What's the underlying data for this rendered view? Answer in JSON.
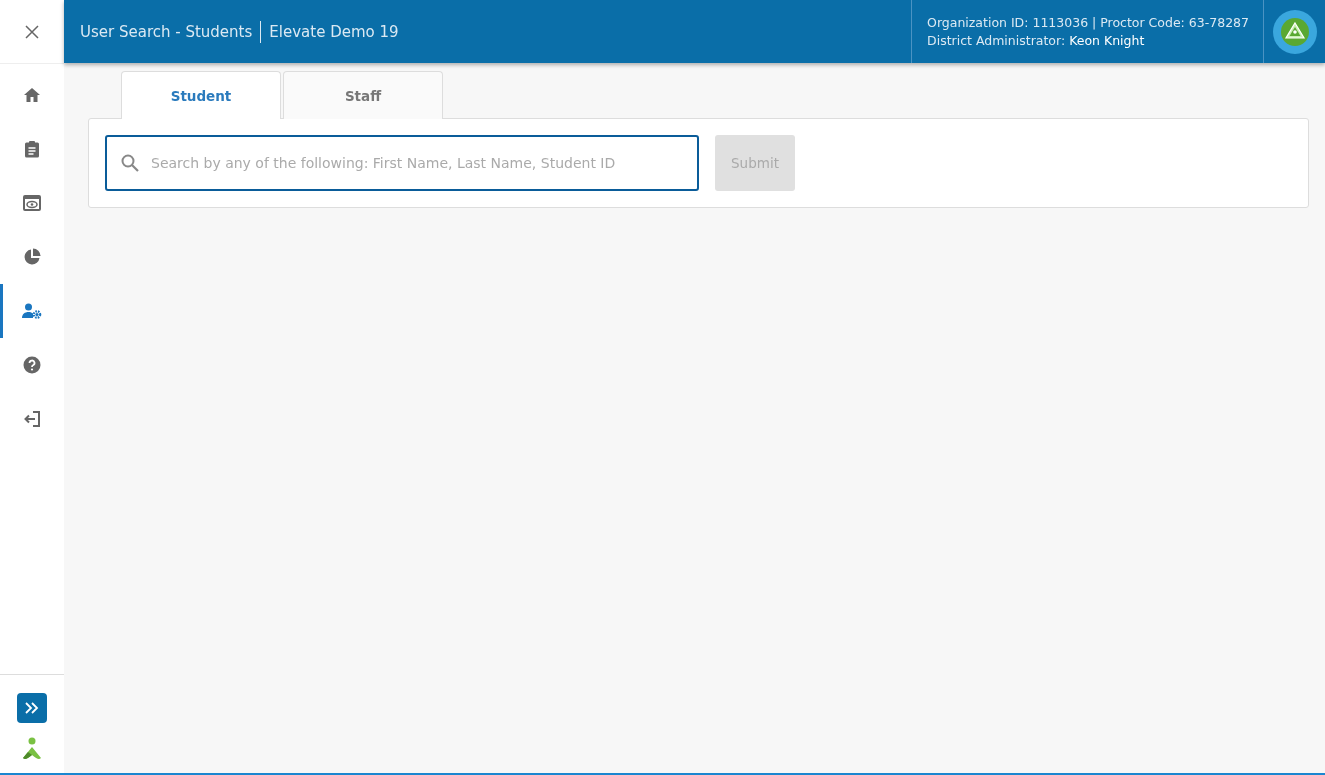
{
  "header": {
    "title": "User Search - Students",
    "subtitle": "Elevate Demo 19",
    "org_info": "Organization ID: 1113036 | Proctor Code: 63-78287",
    "role_label": "District Administrator:",
    "user_name": "Keon Knight"
  },
  "sidebar": {
    "items": [
      {
        "kind": "home",
        "selected": false
      },
      {
        "kind": "clipboard",
        "selected": false
      },
      {
        "kind": "preview",
        "selected": false
      },
      {
        "kind": "chart",
        "selected": false
      },
      {
        "kind": "user-settings",
        "selected": true
      },
      {
        "kind": "help",
        "selected": false
      },
      {
        "kind": "logout",
        "selected": false
      }
    ]
  },
  "tabs": [
    {
      "label": "Student",
      "selected": true
    },
    {
      "label": "Staff",
      "selected": false
    }
  ],
  "search": {
    "placeholder": "Search by any of the following: First Name, Last Name, Student ID"
  },
  "submit": {
    "label": "Submit",
    "disabled": true
  }
}
